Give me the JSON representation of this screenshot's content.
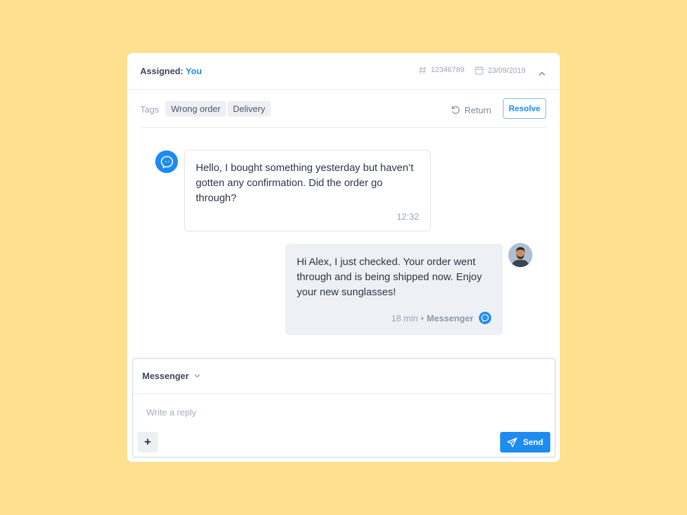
{
  "header": {
    "assigned_label": "Assigned:",
    "assigned_value": "You",
    "ticket_id": "12346789",
    "date": "23/09/2019"
  },
  "tags": {
    "label": "Tags",
    "items": [
      "Wrong order",
      "Delivery"
    ],
    "return_label": "Return",
    "resolve_label": "Resolve"
  },
  "messages": [
    {
      "direction": "incoming",
      "text": "Hello, I bought something yesterday but haven’t gotten any confirmation. Did the order go through?",
      "time": "12:32",
      "avatar_icon": "messenger-icon"
    },
    {
      "direction": "outgoing",
      "text": "Hi Alex, I just checked. Your order went through and is being shipped now. Enjoy your new sunglasses!",
      "time": "18 min",
      "separator": "•",
      "channel": "Messenger",
      "channel_icon": "messenger-icon"
    }
  ],
  "composer": {
    "channel": "Messenger",
    "placeholder": "Write a reply",
    "plus_label": "+",
    "send_label": "Send"
  },
  "colors": {
    "background": "#ffe08f",
    "accent": "#1e8bf0",
    "bubble_out": "#eef0f5"
  }
}
